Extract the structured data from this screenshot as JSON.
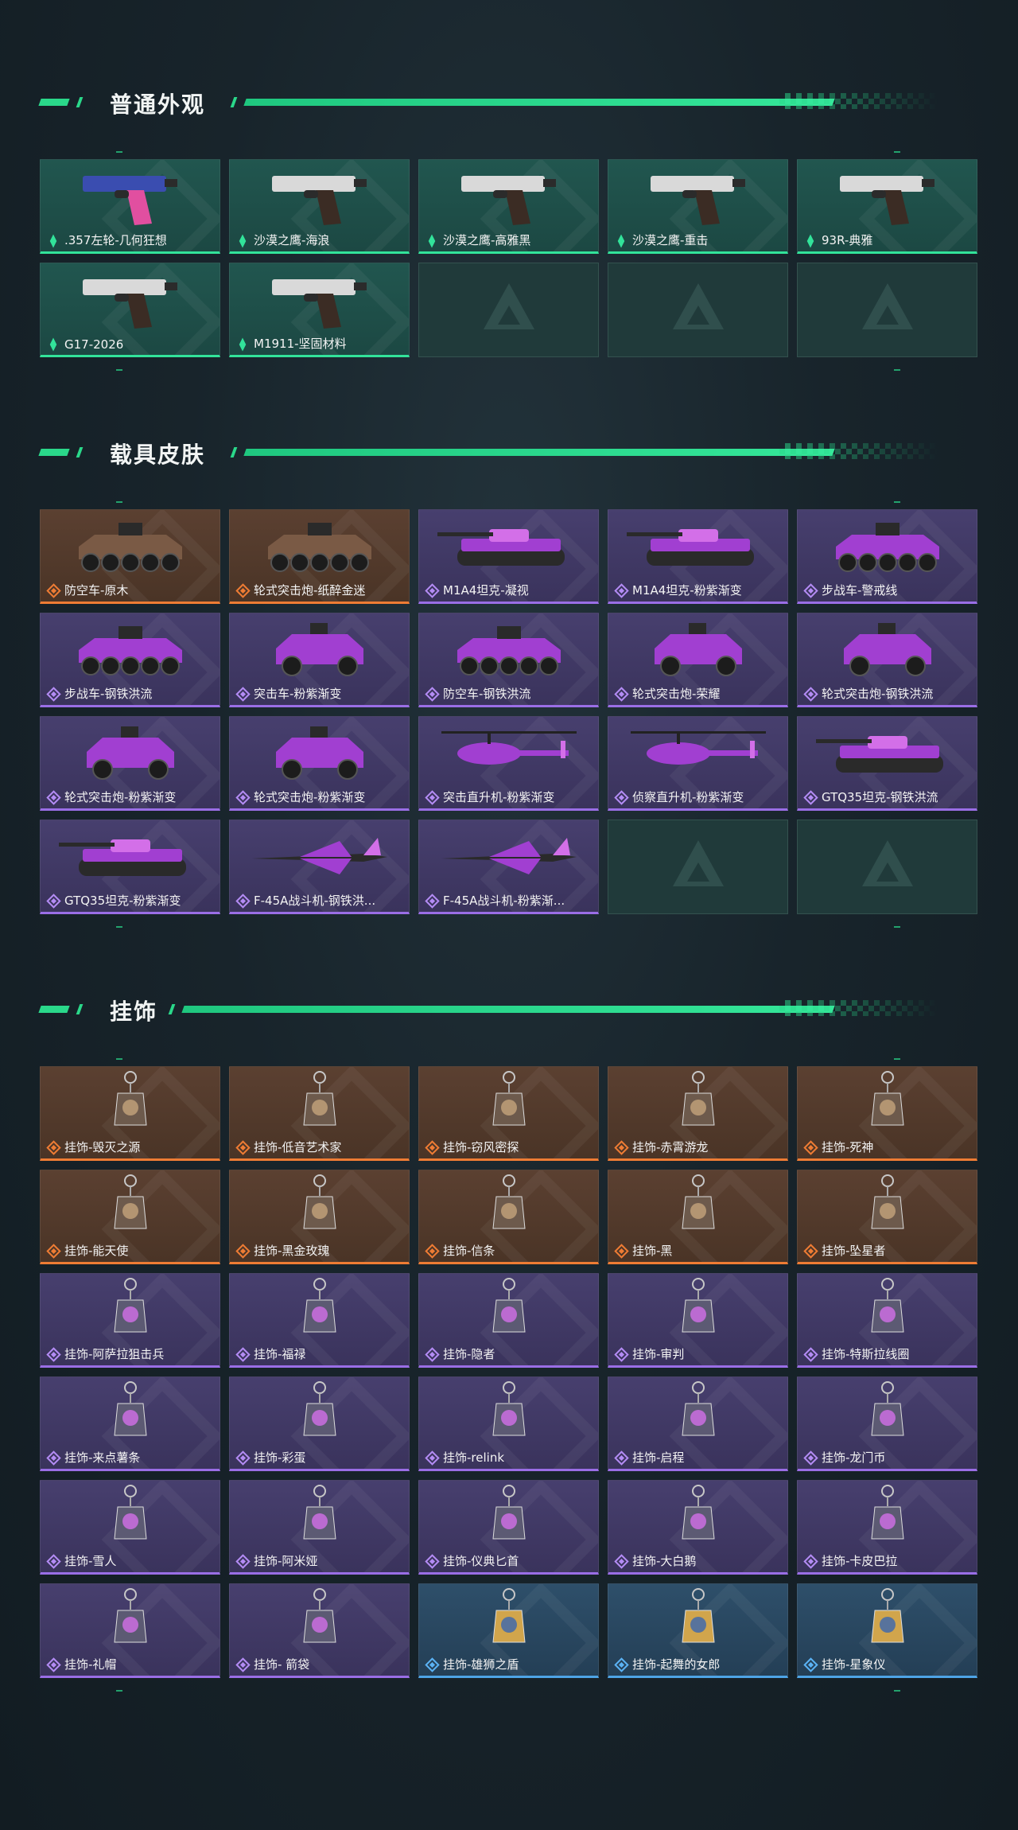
{
  "colors": {
    "accent": "#2ad88a",
    "rarity_green": "#32e39a",
    "rarity_orange": "#ef7c34",
    "rarity_purple": "#9a6ee6",
    "rarity_blue": "#4ea4e6"
  },
  "sections": [
    {
      "title": "普通外观",
      "items": [
        {
          "label": ".357左轮-几何狂想",
          "rarity": "green",
          "icon": "revolver-icon"
        },
        {
          "label": "沙漠之鹰-海浪",
          "rarity": "green",
          "icon": "pistol-icon"
        },
        {
          "label": "沙漠之鹰-高雅黑",
          "rarity": "green",
          "icon": "pistol-icon"
        },
        {
          "label": "沙漠之鹰-重击",
          "rarity": "green",
          "icon": "pistol-icon"
        },
        {
          "label": "93R-典雅",
          "rarity": "green",
          "icon": "pistol-icon"
        },
        {
          "label": "G17-2026",
          "rarity": "green",
          "icon": "pistol-icon"
        },
        {
          "label": "M1911-坚固材料",
          "rarity": "green",
          "icon": "pistol-icon"
        },
        {
          "label": "",
          "rarity": "empty",
          "icon": "placeholder-logo-icon"
        },
        {
          "label": "",
          "rarity": "empty",
          "icon": "placeholder-logo-icon"
        },
        {
          "label": "",
          "rarity": "empty",
          "icon": "placeholder-logo-icon"
        }
      ]
    },
    {
      "title": "载具皮肤",
      "items": [
        {
          "label": "防空车-原木",
          "rarity": "orange",
          "icon": "armored-vehicle-icon"
        },
        {
          "label": "轮式突击炮-纸醉金迷",
          "rarity": "orange",
          "icon": "armored-vehicle-icon"
        },
        {
          "label": "M1A4坦克-凝视",
          "rarity": "purple",
          "icon": "tank-icon"
        },
        {
          "label": "M1A4坦克-粉紫渐变",
          "rarity": "purple",
          "icon": "tank-icon"
        },
        {
          "label": "步战车-警戒线",
          "rarity": "purple",
          "icon": "armored-vehicle-icon"
        },
        {
          "label": "步战车-钢铁洪流",
          "rarity": "purple",
          "icon": "armored-vehicle-icon"
        },
        {
          "label": "突击车-粉紫渐变",
          "rarity": "purple",
          "icon": "jeep-icon"
        },
        {
          "label": "防空车-钢铁洪流",
          "rarity": "purple",
          "icon": "armored-vehicle-icon"
        },
        {
          "label": "轮式突击炮-荣耀",
          "rarity": "purple",
          "icon": "jeep-icon"
        },
        {
          "label": "轮式突击炮-钢铁洪流",
          "rarity": "purple",
          "icon": "jeep-icon"
        },
        {
          "label": "轮式突击炮-粉紫渐变",
          "rarity": "purple",
          "icon": "jeep-icon"
        },
        {
          "label": "轮式突击炮-粉紫渐变",
          "rarity": "purple",
          "icon": "jeep-icon"
        },
        {
          "label": "突击直升机-粉紫渐变",
          "rarity": "purple",
          "icon": "helicopter-icon"
        },
        {
          "label": "侦察直升机-粉紫渐变",
          "rarity": "purple",
          "icon": "helicopter-icon"
        },
        {
          "label": "GTQ35坦克-钢铁洪流",
          "rarity": "purple",
          "icon": "tank-icon"
        },
        {
          "label": "GTQ35坦克-粉紫渐变",
          "rarity": "purple",
          "icon": "tank-icon"
        },
        {
          "label": "F-45A战斗机-钢铁洪...",
          "rarity": "purple",
          "icon": "jet-icon"
        },
        {
          "label": "F-45A战斗机-粉紫渐...",
          "rarity": "purple",
          "icon": "jet-icon"
        },
        {
          "label": "",
          "rarity": "empty",
          "icon": "placeholder-logo-icon"
        },
        {
          "label": "",
          "rarity": "empty",
          "icon": "placeholder-logo-icon"
        }
      ]
    },
    {
      "title": "挂饰",
      "items": [
        {
          "label": "挂饰-毁灭之源",
          "rarity": "orange",
          "icon": "dragon-charm-icon"
        },
        {
          "label": "挂饰-低音艺术家",
          "rarity": "orange",
          "icon": "figure-charm-icon"
        },
        {
          "label": "挂饰-窃风密探",
          "rarity": "orange",
          "icon": "figure-charm-icon"
        },
        {
          "label": "挂饰-赤霄游龙",
          "rarity": "orange",
          "icon": "figure-charm-icon"
        },
        {
          "label": "挂饰-死神",
          "rarity": "orange",
          "icon": "card-charm-icon"
        },
        {
          "label": "挂饰-能天使",
          "rarity": "orange",
          "icon": "card-charm-icon"
        },
        {
          "label": "挂饰-黑金玫瑰",
          "rarity": "orange",
          "icon": "ring-charm-icon"
        },
        {
          "label": "挂饰-信条",
          "rarity": "orange",
          "icon": "figure-charm-icon"
        },
        {
          "label": "挂饰-黑",
          "rarity": "orange",
          "icon": "card-charm-icon"
        },
        {
          "label": "挂饰-坠星者",
          "rarity": "orange",
          "icon": "crystal-charm-icon"
        },
        {
          "label": "挂饰-阿萨拉狙击兵",
          "rarity": "purple",
          "icon": "figure-charm-icon"
        },
        {
          "label": "挂饰-福禄",
          "rarity": "purple",
          "icon": "figure-charm-icon"
        },
        {
          "label": "挂饰-隐者",
          "rarity": "purple",
          "icon": "card-charm-icon"
        },
        {
          "label": "挂饰-审判",
          "rarity": "purple",
          "icon": "card-charm-icon"
        },
        {
          "label": "挂饰-特斯拉线圈",
          "rarity": "purple",
          "icon": "coil-charm-icon"
        },
        {
          "label": "挂饰-来点薯条",
          "rarity": "purple",
          "icon": "fries-charm-icon"
        },
        {
          "label": "挂饰-彩蛋",
          "rarity": "purple",
          "icon": "egg-charm-icon"
        },
        {
          "label": "挂饰-relink",
          "rarity": "purple",
          "icon": "ring-charm-icon"
        },
        {
          "label": "挂饰-启程",
          "rarity": "purple",
          "icon": "ring-charm-icon"
        },
        {
          "label": "挂饰-龙门币",
          "rarity": "purple",
          "icon": "bottle-charm-icon"
        },
        {
          "label": "挂饰-雪人",
          "rarity": "purple",
          "icon": "snowman-charm-icon"
        },
        {
          "label": "挂饰-阿米娅",
          "rarity": "purple",
          "icon": "figure-charm-icon"
        },
        {
          "label": "挂饰-仪典匕首",
          "rarity": "purple",
          "icon": "dagger-charm-icon"
        },
        {
          "label": "挂饰-大白鹅",
          "rarity": "purple",
          "icon": "goose-charm-icon"
        },
        {
          "label": "挂饰-卡皮巴拉",
          "rarity": "purple",
          "icon": "capybara-charm-icon"
        },
        {
          "label": "挂饰-礼帽",
          "rarity": "purple",
          "icon": "hat-charm-icon"
        },
        {
          "label": "挂饰- 箭袋",
          "rarity": "purple",
          "icon": "quiver-charm-icon"
        },
        {
          "label": "挂饰-雄狮之盾",
          "rarity": "blue",
          "icon": "shield-charm-icon"
        },
        {
          "label": "挂饰-起舞的女郎",
          "rarity": "blue",
          "icon": "figure-charm-icon"
        },
        {
          "label": "挂饰-星象仪",
          "rarity": "blue",
          "icon": "astrolabe-charm-icon"
        }
      ]
    }
  ]
}
